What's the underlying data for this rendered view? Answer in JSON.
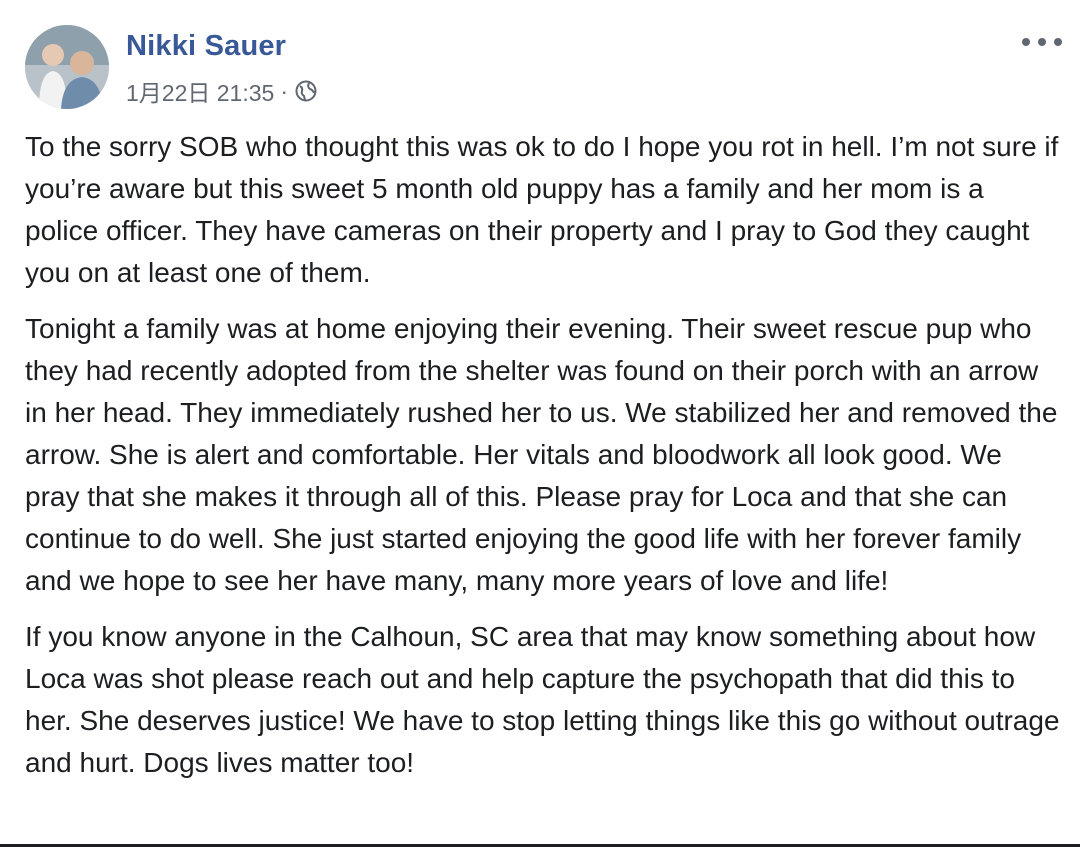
{
  "post": {
    "author_name": "Nikki Sauer",
    "timestamp": "1月22日 21:35",
    "separator": "·",
    "audience_icon": "globe-icon",
    "more_icon": "more-options-icon",
    "paragraphs": [
      "To the sorry SOB who thought this was ok to do I hope you rot in hell. I’m not sure if you’re aware but this sweet 5 month old puppy has a family and her mom is a police officer. They have cameras on their property and I pray to God they caught you on at least one of them.",
      "Tonight a family was at home enjoying their evening. Their sweet rescue pup who they had recently adopted from the shelter was found on their porch with an arrow in her head. They immediately rushed her to us. We stabilized her and removed the arrow. She is alert and comfortable. Her vitals and bloodwork all look good. We pray that she makes it through all of this. Please pray for Loca and that she can continue to do well. She just started enjoying the good life with her forever family and we hope to see her have many, many more years of love and life!",
      "If you know anyone in the Calhoun, SC area that may know something about how Loca was shot please reach out and help capture the psychopath that did this to her. She deserves justice! We have to stop letting things like this go without outrage and hurt. Dogs lives matter too!"
    ]
  },
  "colors": {
    "author_link": "#385898",
    "meta_text": "#616770",
    "body_text": "#1c1e21"
  }
}
